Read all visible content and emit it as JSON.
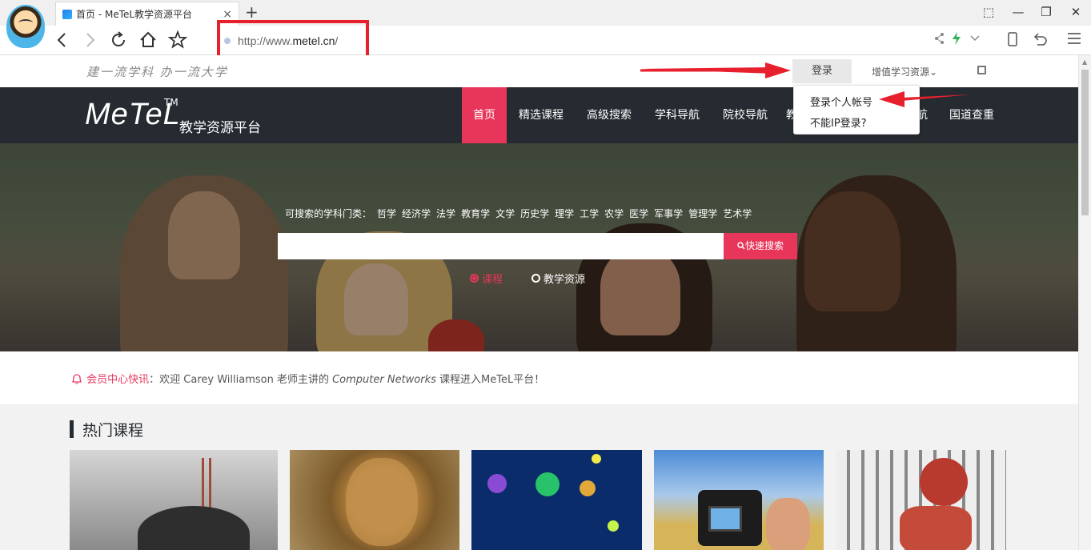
{
  "browser": {
    "tab_title": "首页 - MeTeL教学资源平台",
    "tab_close": "×",
    "new_tab": "+",
    "url_prefix": "http://www.",
    "url_domain": "metel.cn",
    "url_suffix": "/",
    "window_controls": [
      "⬚",
      "—",
      "❐",
      "✕"
    ]
  },
  "site": {
    "slogan": "建一流学科 办一流大学",
    "login": "登录",
    "value_added": "增值学习资源⌄",
    "logo_text": "MeTeL",
    "logo_tm": "TM",
    "logo_sub": "教学资源平台"
  },
  "nav": {
    "items": [
      "首页",
      "精选课程",
      "高级搜索",
      "学科导航",
      "院校导航",
      "教",
      "航",
      "国道查重"
    ]
  },
  "dropdown": {
    "item1": "登录个人帐号",
    "item2": "不能IP登录?"
  },
  "hero": {
    "categories_label": "可搜索的学科门类：",
    "categories": [
      "哲学",
      "经济学",
      "法学",
      "教育学",
      "文学",
      "历史学",
      "理学",
      "工学",
      "农学",
      "医学",
      "军事学",
      "管理学",
      "艺术学"
    ],
    "search_button": "快速搜索",
    "radio_course": "课程",
    "radio_resource": "教学资源"
  },
  "news": {
    "label": "会员中心快讯",
    "text_before": "：欢迎 Carey Williamson 老师主讲的 ",
    "course": "Computer Networks",
    "text_after": " 课程进入MeTeL平台！"
  },
  "hot": {
    "title": "热门课程"
  },
  "colors": {
    "accent": "#e8365a",
    "nav_bg": "#252b30",
    "annotation_red": "#e8202e"
  }
}
